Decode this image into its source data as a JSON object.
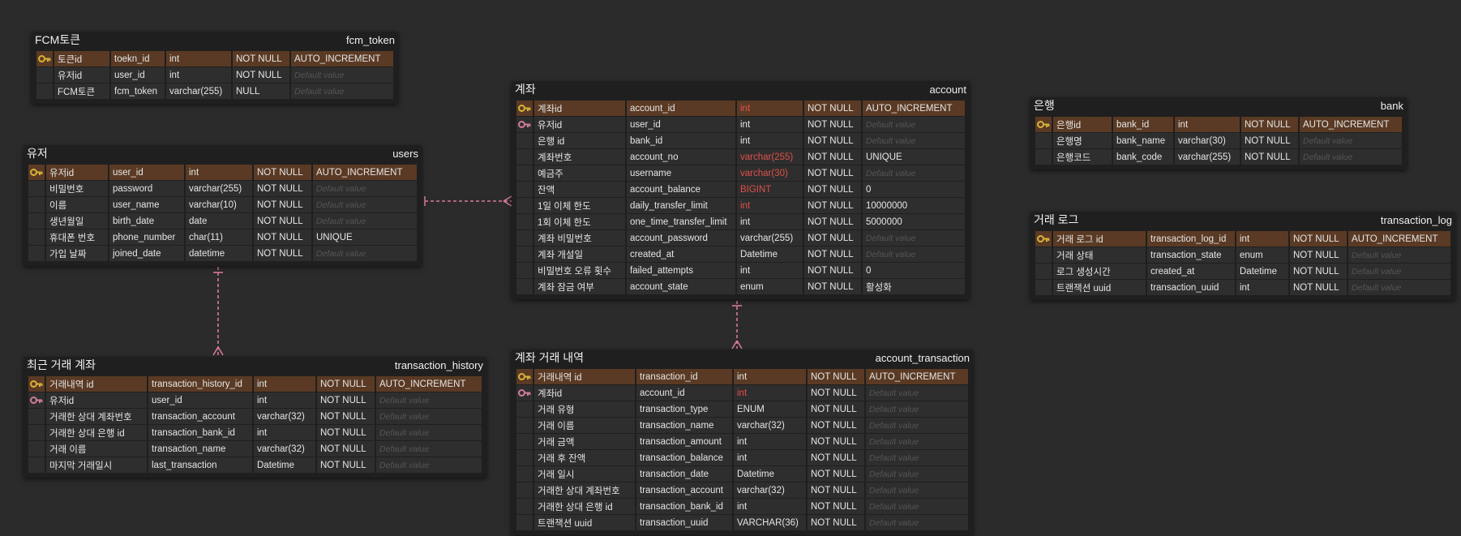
{
  "colors": {
    "background": "#2b2b2b",
    "table_bg": "#1f1f1f",
    "pk_row": "#5a3a24",
    "row": "#2e2e2e",
    "highlight_text": "#e0504a",
    "pk_icon": "#d8b238",
    "fk_icon": "#d07c9a",
    "link": "#d87b95"
  },
  "tables": {
    "fcm_token": {
      "label": "FCM토큰",
      "name": "fcm_token",
      "rows": [
        {
          "key": "pk",
          "a": "토큰id",
          "b": "toekn_id",
          "c": "int",
          "d": "NOT NULL",
          "e": "AUTO_INCREMENT"
        },
        {
          "key": "",
          "a": "유저id",
          "b": "user_id",
          "c": "int",
          "d": "NOT NULL",
          "e": "Default value"
        },
        {
          "key": "",
          "a": "FCM토큰",
          "b": "fcm_token",
          "c": "varchar(255)",
          "d": "NULL",
          "e": "Default value"
        }
      ]
    },
    "users": {
      "label": "유저",
      "name": "users",
      "rows": [
        {
          "key": "pk",
          "a": "유저id",
          "b": "user_id",
          "c": "int",
          "d": "NOT NULL",
          "e": "AUTO_INCREMENT"
        },
        {
          "key": "",
          "a": "비밀번호",
          "b": "password",
          "c": "varchar(255)",
          "d": "NOT NULL",
          "e": "Default value"
        },
        {
          "key": "",
          "a": "이름",
          "b": "user_name",
          "c": "varchar(10)",
          "d": "NOT NULL",
          "e": "Default value"
        },
        {
          "key": "",
          "a": "생년월일",
          "b": "birth_date",
          "c": "date",
          "d": "NOT NULL",
          "e": "Default value"
        },
        {
          "key": "",
          "a": "휴대폰 번호",
          "b": "phone_number",
          "c": "char(11)",
          "d": "NOT NULL",
          "e": "UNIQUE"
        },
        {
          "key": "",
          "a": "가입 날짜",
          "b": "joined_date",
          "c": "datetime",
          "d": "NOT NULL",
          "e": "Default value"
        }
      ]
    },
    "transaction_history": {
      "label": "최근 거래 계좌",
      "name": "transaction_history",
      "rows": [
        {
          "key": "pk",
          "a": "거래내역 id",
          "b": "transaction_history_id",
          "c": "int",
          "d": "NOT NULL",
          "e": "AUTO_INCREMENT"
        },
        {
          "key": "fk",
          "a": "유저id",
          "b": "user_id",
          "c": "int",
          "d": "NOT NULL",
          "e": "Default value"
        },
        {
          "key": "",
          "a": "거래한 상대 계좌번호",
          "b": "transaction_account",
          "c": "varchar(32)",
          "d": "NOT NULL",
          "e": "Default value"
        },
        {
          "key": "",
          "a": "거래한 상대 은행 id",
          "b": "transaction_bank_id",
          "c": "int",
          "d": "NOT NULL",
          "e": "Default value"
        },
        {
          "key": "",
          "a": "거래 이름",
          "b": "transaction_name",
          "c": "varchar(32)",
          "d": "NOT NULL",
          "e": "Default value"
        },
        {
          "key": "",
          "a": "마지막 거래일시",
          "b": "last_transaction",
          "c": "Datetime",
          "d": "NOT NULL",
          "e": "Default value"
        }
      ]
    },
    "account": {
      "label": "계좌",
      "name": "account",
      "rows": [
        {
          "key": "pk",
          "a": "계좌id",
          "b": "account_id",
          "c": "int",
          "cred": true,
          "d": "NOT NULL",
          "e": "AUTO_INCREMENT"
        },
        {
          "key": "fk",
          "a": "유저id",
          "b": "user_id",
          "c": "int",
          "d": "NOT NULL",
          "e": "Default value"
        },
        {
          "key": "",
          "a": "은행 id",
          "b": "bank_id",
          "c": "int",
          "d": "NOT NULL",
          "e": "Default value"
        },
        {
          "key": "",
          "a": "계좌번호",
          "b": "account_no",
          "c": "varchar(255)",
          "cred": true,
          "d": "NOT NULL",
          "e": "UNIQUE"
        },
        {
          "key": "",
          "a": "예금주",
          "b": "username",
          "c": "varchar(30)",
          "cred": true,
          "d": "NOT NULL",
          "e": "Default value"
        },
        {
          "key": "",
          "a": "잔액",
          "b": "account_balance",
          "c": "BIGINT",
          "cred": true,
          "d": "NOT NULL",
          "e": "0"
        },
        {
          "key": "",
          "a": "1일 이체 한도",
          "b": "daily_transfer_limit",
          "c": "int",
          "cred": true,
          "d": "NOT NULL",
          "e": "10000000"
        },
        {
          "key": "",
          "a": "1회 이체 한도",
          "b": "one_time_transfer_limit",
          "c": "int",
          "d": "NOT NULL",
          "e": "5000000"
        },
        {
          "key": "",
          "a": "계좌 비밀번호",
          "b": "account_password",
          "c": "varchar(255)",
          "d": "NOT NULL",
          "e": "Default value"
        },
        {
          "key": "",
          "a": "계좌 개설일",
          "b": "created_at",
          "c": "Datetime",
          "d": "NOT NULL",
          "e": "Default value"
        },
        {
          "key": "",
          "a": "비밀번호 오류 횟수",
          "b": "failed_attempts",
          "c": "int",
          "d": "NOT NULL",
          "e": "0"
        },
        {
          "key": "",
          "a": "계좌 잠금 여부",
          "b": "account_state",
          "c": "enum",
          "d": "NOT NULL",
          "e": "활성화"
        }
      ]
    },
    "account_transaction": {
      "label": "계좌 거래 내역",
      "name": "account_transaction",
      "rows": [
        {
          "key": "pk",
          "a": "거래내역 id",
          "b": "transaction_id",
          "c": "int",
          "d": "NOT NULL",
          "e": "AUTO_INCREMENT"
        },
        {
          "key": "fk",
          "a": "계좌id",
          "b": "account_id",
          "c": "int",
          "cred": true,
          "d": "NOT NULL",
          "e": "Default value"
        },
        {
          "key": "",
          "a": "거래 유형",
          "b": "transaction_type",
          "c": "ENUM",
          "d": "NOT NULL",
          "e": "Default value"
        },
        {
          "key": "",
          "a": "거래 이름",
          "b": "transaction_name",
          "c": "varchar(32)",
          "d": "NOT NULL",
          "e": "Default value"
        },
        {
          "key": "",
          "a": "거래 금액",
          "b": "transaction_amount",
          "c": "int",
          "d": "NOT NULL",
          "e": "Default value"
        },
        {
          "key": "",
          "a": "거래 후 잔액",
          "b": "transaction_balance",
          "c": "int",
          "d": "NOT NULL",
          "e": "Default value"
        },
        {
          "key": "",
          "a": "거래 일시",
          "b": "transaction_date",
          "c": "Datetime",
          "d": "NOT NULL",
          "e": "Default value"
        },
        {
          "key": "",
          "a": "거래한 상대 계좌번호",
          "b": "transaction_account",
          "c": "varchar(32)",
          "d": "NOT NULL",
          "e": "Default value"
        },
        {
          "key": "",
          "a": "거래한 상대 은행 id",
          "b": "transaction_bank_id",
          "c": "int",
          "d": "NOT NULL",
          "e": "Default value"
        },
        {
          "key": "",
          "a": "트랜잭션 uuid",
          "b": "transaction_uuid",
          "c": "VARCHAR(36)",
          "d": "NOT NULL",
          "e": "Default value"
        }
      ]
    },
    "bank": {
      "label": "은행",
      "name": "bank",
      "rows": [
        {
          "key": "pk",
          "a": "은행id",
          "b": "bank_id",
          "c": "int",
          "d": "NOT NULL",
          "e": "AUTO_INCREMENT"
        },
        {
          "key": "",
          "a": "은행명",
          "b": "bank_name",
          "c": "varchar(30)",
          "d": "NOT NULL",
          "e": "Default value"
        },
        {
          "key": "",
          "a": "은행코드",
          "b": "bank_code",
          "c": "varchar(255)",
          "d": "NOT NULL",
          "e": "Default value"
        }
      ]
    },
    "transaction_log": {
      "label": "거래 로그",
      "name": "transaction_log",
      "rows": [
        {
          "key": "pk",
          "a": "거래 로그 id",
          "b": "transaction_log_id",
          "c": "int",
          "d": "NOT NULL",
          "e": "AUTO_INCREMENT"
        },
        {
          "key": "",
          "a": "거래 상태",
          "b": "transaction_state",
          "c": "enum",
          "d": "NOT NULL",
          "e": "Default value"
        },
        {
          "key": "",
          "a": "로그 생성시간",
          "b": "created_at",
          "c": "Datetime",
          "d": "NOT NULL",
          "e": "Default value"
        },
        {
          "key": "",
          "a": "트랜잭션 uuid",
          "b": "transaction_uuid",
          "c": "int",
          "d": "NOT NULL",
          "e": "Default value"
        }
      ]
    }
  }
}
